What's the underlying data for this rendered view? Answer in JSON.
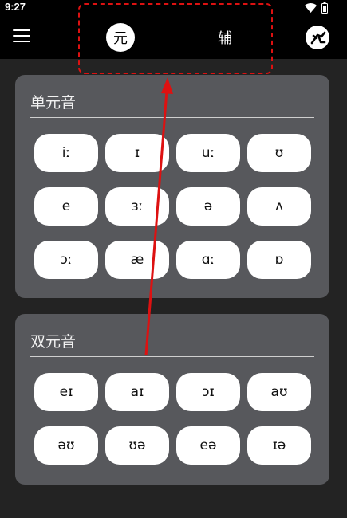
{
  "status_bar": {
    "time": "9:27"
  },
  "app_bar": {
    "tabs": [
      {
        "label": "元",
        "selected": true
      },
      {
        "label": "辅",
        "selected": false
      }
    ]
  },
  "sections": [
    {
      "title": "单元音",
      "phonemes": [
        "iː",
        "ɪ",
        "uː",
        "ʊ",
        "e",
        "ɜː",
        "ə",
        "ʌ",
        "ɔː",
        "æ",
        "ɑː",
        "ɒ"
      ]
    },
    {
      "title": "双元音",
      "phonemes": [
        "eɪ",
        "aɪ",
        "ɔɪ",
        "aʊ",
        "əʊ",
        "ʊə",
        "eə",
        "ɪə"
      ]
    }
  ],
  "colors": {
    "accent_annotation": "#dd1111",
    "card_bg": "#57585c",
    "page_bg": "#232323"
  }
}
